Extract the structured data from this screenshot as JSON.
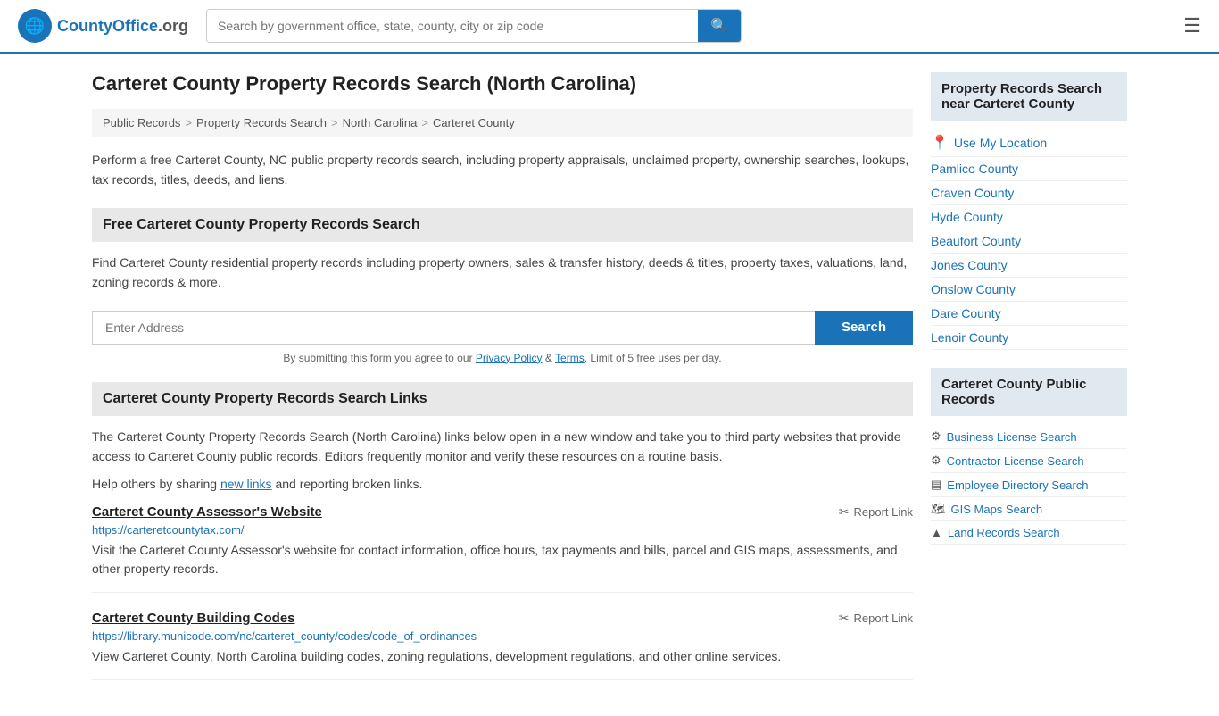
{
  "header": {
    "logo_text": "CountyOffice",
    "logo_suffix": ".org",
    "search_placeholder": "Search by government office, state, county, city or zip code"
  },
  "page": {
    "title": "Carteret County Property Records Search (North Carolina)",
    "description": "Perform a free Carteret County, NC public property records search, including property appraisals, unclaimed property, ownership searches, lookups, tax records, titles, deeds, and liens."
  },
  "breadcrumb": {
    "items": [
      "Public Records",
      "Property Records Search",
      "North Carolina",
      "Carteret County"
    ]
  },
  "free_search": {
    "section_title": "Free Carteret County Property Records Search",
    "description": "Find Carteret County residential property records including property owners, sales & transfer history, deeds & titles, property taxes, valuations, land, zoning records & more.",
    "address_placeholder": "Enter Address",
    "search_button": "Search",
    "terms_text": "By submitting this form you agree to our",
    "privacy_label": "Privacy Policy",
    "and_text": "&",
    "terms_label": "Terms",
    "limit_text": "Limit of 5 free uses per day."
  },
  "links_section": {
    "section_title": "Carteret County Property Records Search Links",
    "description": "The Carteret County Property Records Search (North Carolina) links below open in a new window and take you to third party websites that provide access to Carteret County public records. Editors frequently monitor and verify these resources on a routine basis.",
    "share_text": "Help others by sharing",
    "new_links_label": "new links",
    "and_reporting_text": "and reporting broken links.",
    "links": [
      {
        "title": "Carteret County Assessor's Website",
        "url": "https://carteretcountytax.com/",
        "description": "Visit the Carteret County Assessor's website for contact information, office hours, tax payments and bills, parcel and GIS maps, assessments, and other property records.",
        "report_label": "Report Link"
      },
      {
        "title": "Carteret County Building Codes",
        "url": "https://library.municode.com/nc/carteret_county/codes/code_of_ordinances",
        "description": "View Carteret County, North Carolina building codes, zoning regulations, development regulations, and other online services.",
        "report_label": "Report Link"
      }
    ]
  },
  "sidebar": {
    "nearby_title": "Property Records Search near Carteret County",
    "use_location_label": "Use My Location",
    "nearby_counties": [
      "Pamlico County",
      "Craven County",
      "Hyde County",
      "Beaufort County",
      "Jones County",
      "Onslow County",
      "Dare County",
      "Lenoir County"
    ],
    "public_records_title": "Carteret County Public Records",
    "public_records": [
      {
        "label": "Business License Search",
        "icon": "⚙"
      },
      {
        "label": "Contractor License Search",
        "icon": "⚙"
      },
      {
        "label": "Employee Directory Search",
        "icon": "▤"
      },
      {
        "label": "GIS Maps Search",
        "icon": "🗺"
      },
      {
        "label": "Land Records Search",
        "icon": "▲"
      }
    ]
  }
}
